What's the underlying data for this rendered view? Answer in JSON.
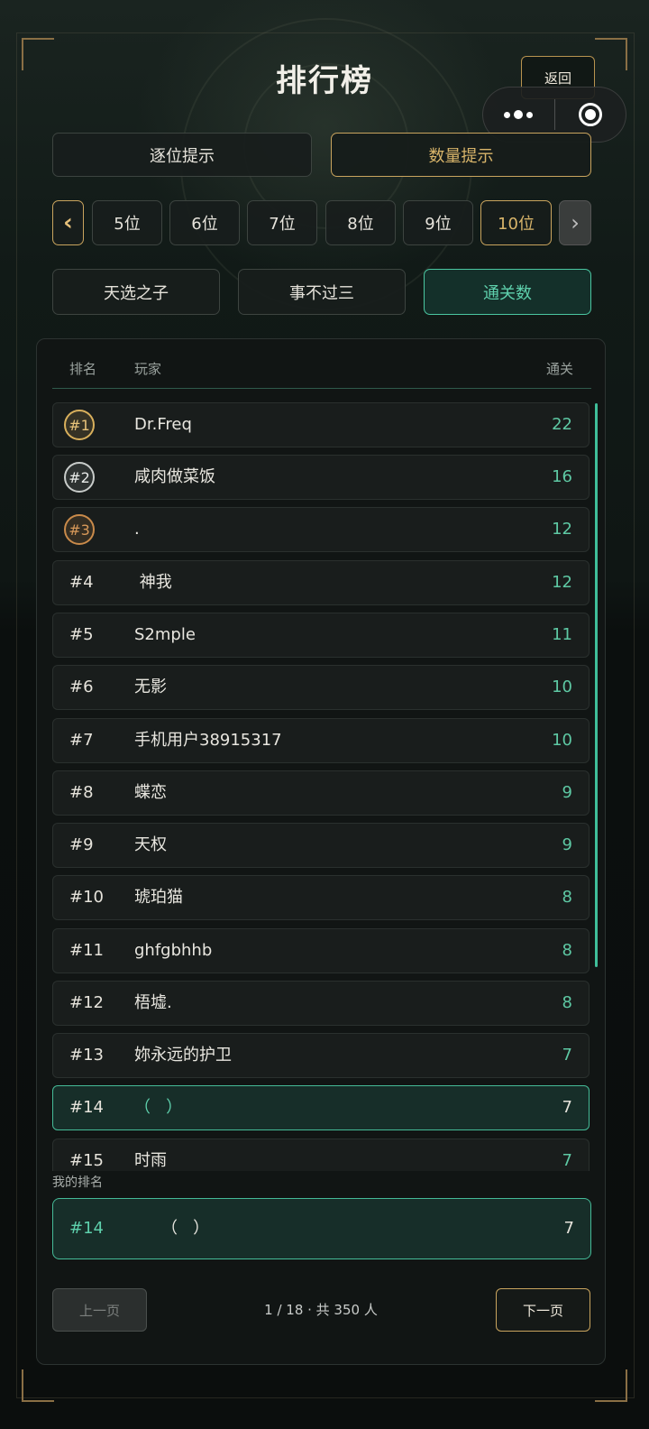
{
  "header": {
    "title": "排行榜",
    "back_label": "返回"
  },
  "mode_tabs": [
    {
      "label": "逐位提示",
      "active": false
    },
    {
      "label": "数量提示",
      "active": true
    }
  ],
  "digit_tabs": {
    "items": [
      "5位",
      "6位",
      "7位",
      "8位",
      "9位",
      "10位"
    ],
    "active": "10位",
    "prev_icon": "‹",
    "next_icon": "›"
  },
  "category_tabs": [
    {
      "label": "天选之子",
      "active": false
    },
    {
      "label": "事不过三",
      "active": false
    },
    {
      "label": "通关数",
      "active": true
    }
  ],
  "table": {
    "col_rank": "排名",
    "col_player": "玩家",
    "col_score": "通关",
    "rows": [
      {
        "rank": "#1",
        "name": "Dr.Freq",
        "score": "22"
      },
      {
        "rank": "#2",
        "name": "咸肉做菜饭",
        "score": "16"
      },
      {
        "rank": "#3",
        "name": ".",
        "score": "12"
      },
      {
        "rank": "#4",
        "name": "󠀠 神我󠀠 󠀠",
        "score": "12"
      },
      {
        "rank": "#5",
        "name": "S2mple",
        "score": "11"
      },
      {
        "rank": "#6",
        "name": "无影",
        "score": "10"
      },
      {
        "rank": "#7",
        "name": "手机用户38915317",
        "score": "10"
      },
      {
        "rank": "#8",
        "name": "蝶恋",
        "score": "9"
      },
      {
        "rank": "#9",
        "name": "天权",
        "score": "9"
      },
      {
        "rank": "#10",
        "name": "琥珀猫",
        "score": "8"
      },
      {
        "rank": "#11",
        "name": "ghfgbhhb",
        "score": "8"
      },
      {
        "rank": "#12",
        "name": "梧墟.",
        "score": "8"
      },
      {
        "rank": "#13",
        "name": "妳永远的护卫",
        "score": "7"
      },
      {
        "rank": "#14",
        "name": "󠀠（󠀠 󠀠 󠀠 ）󠀠",
        "score": "7"
      },
      {
        "rank": "#15",
        "name": "时雨",
        "score": "7"
      }
    ]
  },
  "my_rank": {
    "label": "我的排名",
    "rank": "#14",
    "name": "󠀠（󠀠 󠀠 󠀠 ）󠀠",
    "score": "7"
  },
  "pagination": {
    "prev_label": "上一页",
    "info": "1 / 18 · 共 350 人",
    "next_label": "下一页"
  },
  "colors": {
    "gold": "#c9a45e",
    "teal": "#4bc7a2",
    "background": "#0c1110"
  }
}
